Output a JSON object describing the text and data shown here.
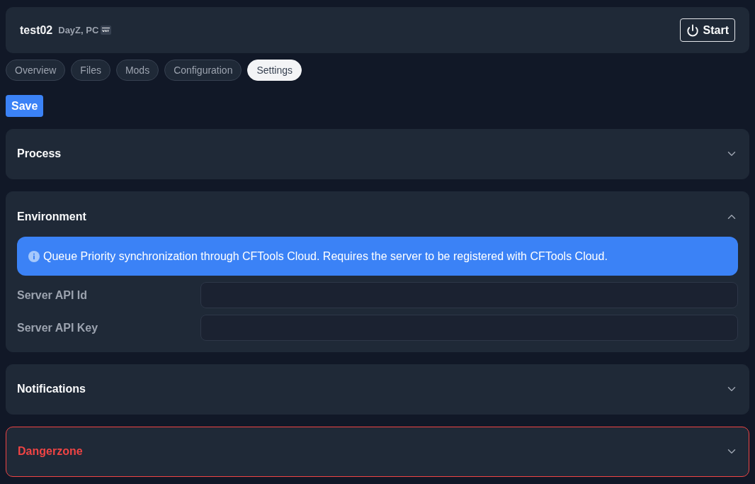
{
  "header": {
    "title": "test02",
    "subtitle": "DayZ, PC",
    "start_button": "Start"
  },
  "tabs": [
    {
      "label": "Overview",
      "selected": false
    },
    {
      "label": "Files",
      "selected": false
    },
    {
      "label": "Mods",
      "selected": false
    },
    {
      "label": "Configuration",
      "selected": false
    },
    {
      "label": "Settings",
      "selected": true
    }
  ],
  "save_button": "Save",
  "sections": [
    {
      "title": "Process",
      "kind": "normal",
      "expanded": false
    },
    {
      "title": "Environment",
      "kind": "normal",
      "expanded": true,
      "alert": "Queue Priority synchronization through CFTools Cloud. Requires the server to be registered with CFTools Cloud.",
      "fields": [
        {
          "label": "Server API Id"
        },
        {
          "label": "Server API Key"
        }
      ]
    },
    {
      "title": "Notifications",
      "kind": "normal",
      "expanded": false
    },
    {
      "title": "Dangerzone",
      "kind": "danger",
      "expanded": false
    }
  ]
}
